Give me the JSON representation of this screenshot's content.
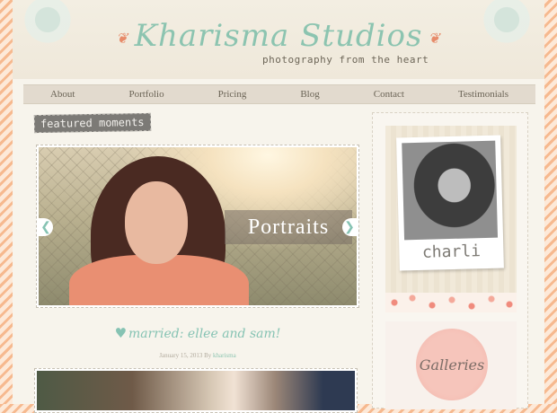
{
  "header": {
    "brand": "Kharisma Studios",
    "tagline": "photography from the heart"
  },
  "nav": {
    "items": [
      "About",
      "Portfolio",
      "Pricing",
      "Blog",
      "Contact",
      "Testimonials"
    ]
  },
  "featured": {
    "label": "featured moments",
    "slide_caption": "Portraits",
    "prev_glyph": "❮",
    "next_glyph": "❯"
  },
  "post": {
    "title": "married: ellee and sam!",
    "date": "January 15, 2013",
    "by": "By",
    "author": "kharisma"
  },
  "sidebar": {
    "profile_name": "charli",
    "galleries_label": "Galleries"
  },
  "colors": {
    "accent": "#8cc4b0",
    "coral": "#f6b98f",
    "background": "#f7f4ec"
  }
}
